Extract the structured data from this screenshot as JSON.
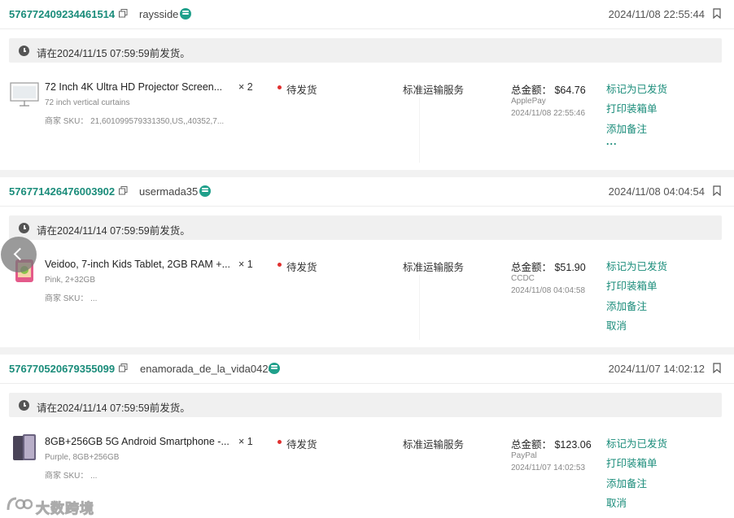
{
  "orders": [
    {
      "id": "576772409234461514",
      "username": "raysside",
      "date": "2024/11/08 22:55:44",
      "deadline": "请在2024/11/15 07:59:59前发货。",
      "product": {
        "title": "72 Inch 4K Ultra HD Projector Screen...",
        "variant": "72 inch vertical curtains",
        "sku": "商家 SKU： 21,601099579331350,US,,40352,7..."
      },
      "qty": "× 2",
      "status": "待发货",
      "shipping": "标准运输服务",
      "total": "总金额： $64.76",
      "payment_method": "ApplePay",
      "payment_time": "2024/11/08 22:55:46",
      "actions": [
        "标记为已发货",
        "打印装箱单",
        "添加备注",
        "..."
      ]
    },
    {
      "id": "576771426476003902",
      "username": "usermada35",
      "date": "2024/11/08 04:04:54",
      "deadline": "请在2024/11/14 07:59:59前发货。",
      "product": {
        "title": "Veidoo, 7-inch Kids Tablet, 2GB RAM +...",
        "variant": "Pink, 2+32GB",
        "sku": "商家 SKU： ..."
      },
      "qty": "× 1",
      "status": "待发货",
      "shipping": "标准运输服务",
      "total": "总金额： $51.90",
      "payment_method": "CCDC",
      "payment_time": "2024/11/08 04:04:58",
      "actions": [
        "标记为已发货",
        "打印装箱单",
        "添加备注",
        "取消"
      ]
    },
    {
      "id": "576770520679355099",
      "username": "enamorada_de_la_vida0424",
      "date": "2024/11/07 14:02:12",
      "deadline": "请在2024/11/14 07:59:59前发货。",
      "product": {
        "title": "8GB+256GB 5G Android Smartphone -...",
        "variant": "Purple, 8GB+256GB",
        "sku": "商家 SKU： ..."
      },
      "qty": "× 1",
      "status": "待发货",
      "shipping": "标准运输服务",
      "total": "总金额： $123.06",
      "payment_method": "PayPal",
      "payment_time": "2024/11/07 14:02:53",
      "actions": [
        "标记为已发货",
        "打印装箱单",
        "添加备注",
        "取消"
      ]
    }
  ],
  "watermark": {
    "text": "大数跨境"
  },
  "colors": {
    "accent": "#1a8c7a",
    "status_dot": "#e0302f",
    "chat_icon": "#20a08b"
  }
}
